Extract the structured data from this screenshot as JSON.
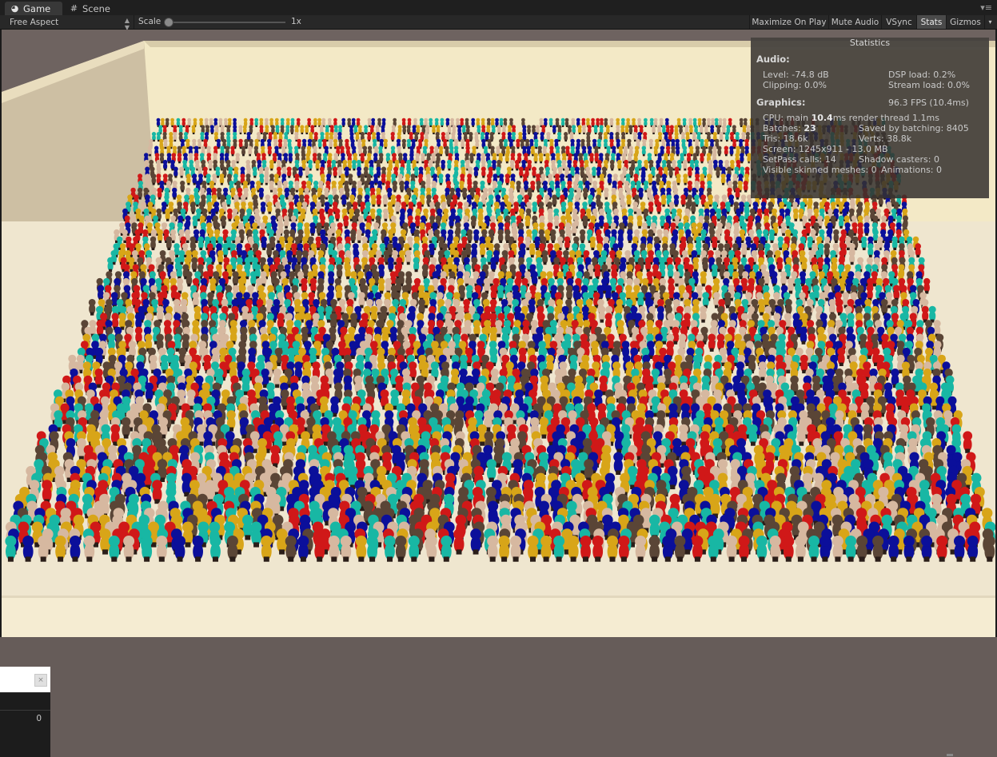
{
  "tabs": [
    {
      "label": "Game",
      "icon": "pacman-game-icon"
    },
    {
      "label": "Scene",
      "icon": "grid-scene-icon"
    }
  ],
  "toolbar": {
    "aspect": "Free Aspect",
    "scale_label": "Scale",
    "scale_value": "1x",
    "buttons": {
      "maximize": "Maximize On Play",
      "mute": "Mute Audio",
      "vsync": "VSync",
      "stats": "Stats",
      "gizmos": "Gizmos"
    }
  },
  "stats": {
    "title": "Statistics",
    "audio_header": "Audio:",
    "level": "Level: -74.8 dB",
    "clipping": "Clipping: 0.0%",
    "dsp": "DSP load: 0.2%",
    "stream": "Stream load: 0.0%",
    "graphics_header": "Graphics:",
    "fps": "96.3 FPS (10.4ms)",
    "cpu_prefix": "CPU: main ",
    "cpu_main": "10.4",
    "cpu_suffix": "ms  render thread 1.1ms",
    "batches_prefix": "Batches: ",
    "batches": "23",
    "saved": "Saved by batching: 8405",
    "tris": "Tris: 18.6k",
    "verts": "Verts: 38.8k",
    "screen": "Screen: 1245x911 - 13.0 MB",
    "setpass": "SetPass calls: 14",
    "shadow": "Shadow casters: 0",
    "skinned": "Visible skinned meshes: 0",
    "animations": "Animations: 0"
  },
  "bottom_panel": {
    "value": "0"
  },
  "colors": {
    "floor": "#efe6cf",
    "wall": "#f3e9c8",
    "crowd": [
      "#d01818",
      "#0b0f9a",
      "#18b7a4",
      "#d8a518",
      "#5a4536",
      "#d6b8a0"
    ]
  }
}
